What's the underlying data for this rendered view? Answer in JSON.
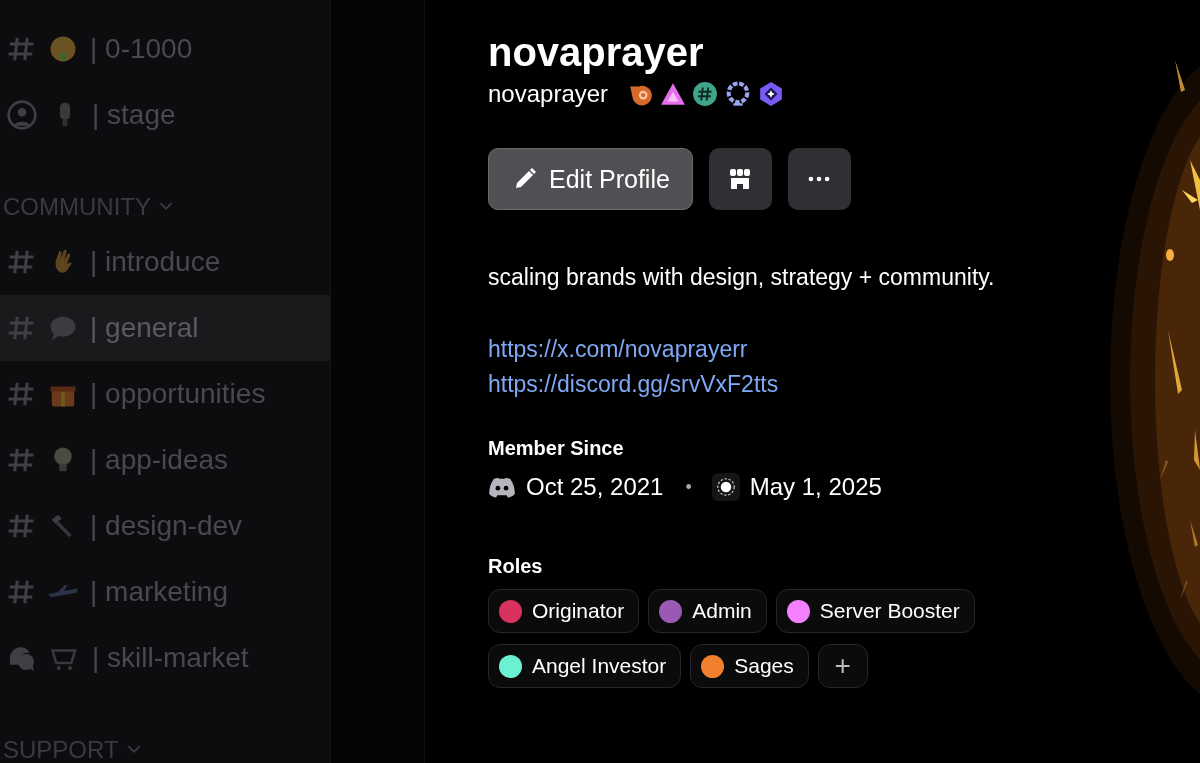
{
  "sidebar": {
    "items": [
      {
        "kind": "text_channel",
        "label": "| 0-1000",
        "selected": false
      },
      {
        "kind": "stage_channel",
        "label": "| stage",
        "selected": false
      },
      {
        "kind": "category",
        "label": "COMMUNITY"
      },
      {
        "kind": "text_channel",
        "label": "| introduce",
        "selected": false
      },
      {
        "kind": "text_channel",
        "label": "| general",
        "selected": true
      },
      {
        "kind": "text_channel",
        "label": "| opportunities",
        "selected": false
      },
      {
        "kind": "text_channel",
        "label": "| app-ideas",
        "selected": false
      },
      {
        "kind": "text_channel",
        "label": "| design-dev",
        "selected": false
      },
      {
        "kind": "text_channel",
        "label": "| marketing",
        "selected": false
      },
      {
        "kind": "forum_channel",
        "label": "| skill-market",
        "selected": false
      },
      {
        "kind": "category",
        "label": "SUPPORT"
      }
    ]
  },
  "profile": {
    "display_name": "novaprayer",
    "username": "novaprayer",
    "buttons": {
      "edit_profile": "Edit Profile"
    },
    "bio": "scaling brands with design, strategy + community.",
    "links": [
      "https://x.com/novaprayerr",
      "https://discord.gg/srvVxF2tts"
    ],
    "member_since": {
      "label": "Member Since",
      "separator": "•",
      "dates": [
        {
          "kind": "discord",
          "text": "Oct 25, 2021"
        },
        {
          "kind": "server",
          "text": "May 1, 2025"
        }
      ]
    },
    "roles": {
      "label": "Roles",
      "add": "+",
      "items": [
        {
          "name": "Originator",
          "color": "#d9325e"
        },
        {
          "name": "Admin",
          "color": "#9b59b6"
        },
        {
          "name": "Server Booster",
          "color": "#f47fff"
        },
        {
          "name": "Angel Investor",
          "color": "#6cf0d4"
        },
        {
          "name": "Sages",
          "color": "#f0802e"
        }
      ]
    }
  }
}
